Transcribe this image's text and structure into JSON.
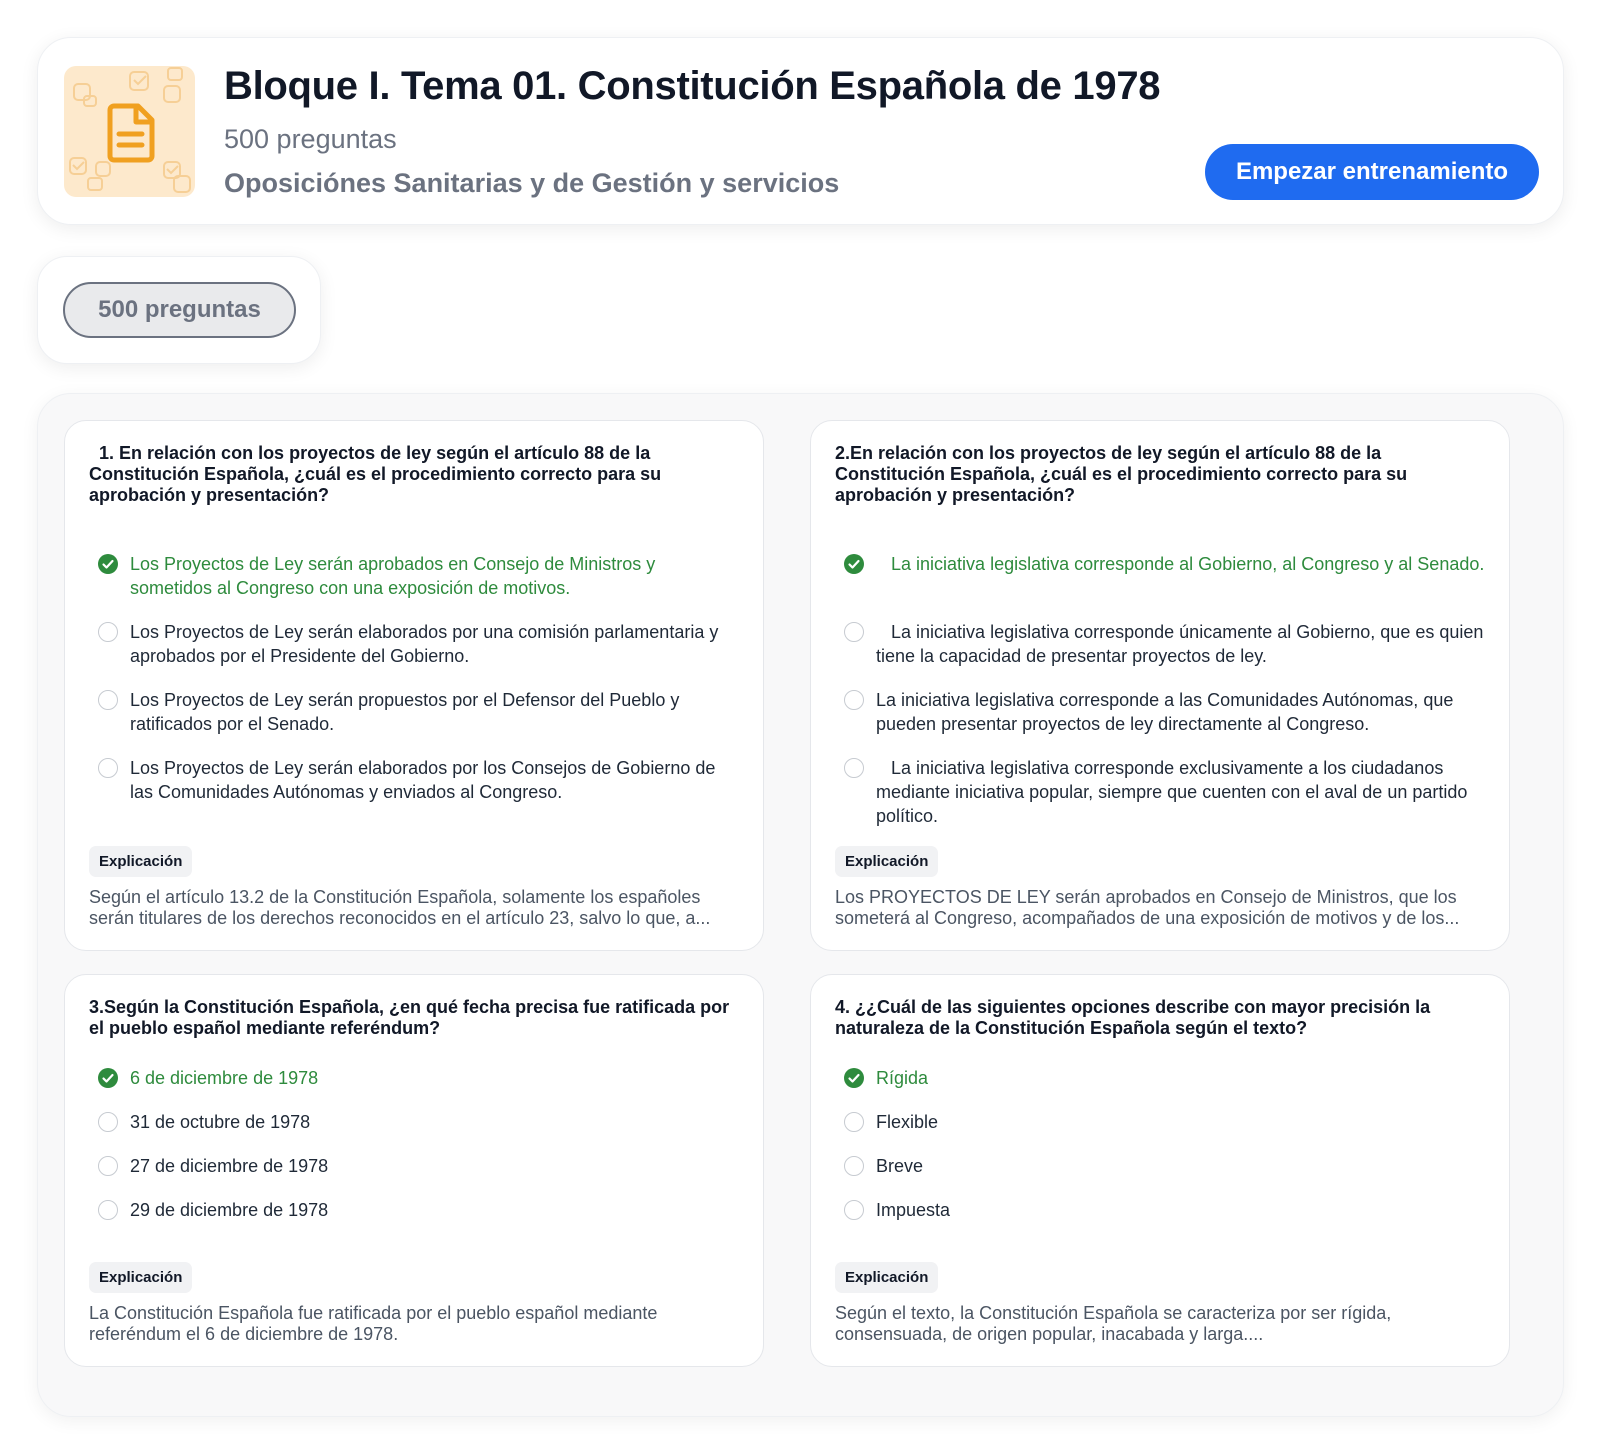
{
  "header": {
    "title": "Bloque I. Tema 01. Constitución Española de 1978",
    "question_count": "500 preguntas",
    "organization": "Oposiciónes Sanitarias y de Gestión y servicios",
    "start_button": "Empezar entrenamiento",
    "thumbnail_icon": "document-icon"
  },
  "filter": {
    "chip_label": "500 preguntas"
  },
  "explanation_label": "Explicación",
  "colors": {
    "accent": "#1f6bf0",
    "correct": "#2e8b3d",
    "thumbnail_bg": "#fde9cc",
    "thumbnail_icon": "#f0a020"
  },
  "questions": [
    {
      "text": "  1. En relación con los proyectos de ley según el artículo 88 de la Constitución Española, ¿cuál es el procedimiento correcto para su aprobación y presentación?",
      "options": [
        {
          "text": "Los Proyectos de Ley serán aprobados en Consejo de Ministros y sometidos al Congreso con una exposición de motivos.",
          "correct": true
        },
        {
          "text": "Los Proyectos de Ley serán elaborados por una comisión parlamentaria y aprobados por el Presidente del Gobierno.",
          "correct": false
        },
        {
          "text": "Los Proyectos de Ley serán propuestos por el Defensor del Pueblo y ratificados por el Senado.",
          "correct": false
        },
        {
          "text": "Los Proyectos de Ley serán elaborados por los Consejos de Gobierno de las Comunidades Autónomas y enviados al Congreso.",
          "correct": false
        }
      ],
      "explanation": "Según el artículo 13.2 de la Constitución Española, solamente los españoles serán titulares de los derechos reconocidos en el artículo 23, salvo lo que, a..."
    },
    {
      "text": "2.En relación con los proyectos de ley según el artículo 88 de la Constitución Española, ¿cuál es el procedimiento correcto para su aprobación y presentación?",
      "options": [
        {
          "text": "   La iniciativa legislativa corresponde al Gobierno, al Congreso y al Senado.",
          "correct": true
        },
        {
          "text": "   La iniciativa legislativa corresponde únicamente al Gobierno, que es quien tiene la capacidad de presentar proyectos de ley.",
          "correct": false
        },
        {
          "text": "La iniciativa legislativa corresponde a las Comunidades Autónomas, que pueden presentar proyectos de ley directamente al Congreso.",
          "correct": false
        },
        {
          "text": "   La iniciativa legislativa corresponde exclusivamente a los ciudadanos mediante iniciativa popular, siempre que cuenten con el aval de un partido político.",
          "correct": false
        }
      ],
      "explanation": "Los PROYECTOS DE LEY serán aprobados en Consejo de Ministros, que los someterá al Congreso, acompañados de una exposición de motivos y de los..."
    },
    {
      "text": "3.Según la Constitución Española, ¿en qué fecha precisa fue ratificada por el pueblo español mediante referéndum?",
      "options": [
        {
          "text": "6 de diciembre de 1978",
          "correct": true
        },
        {
          "text": "31 de octubre de 1978",
          "correct": false
        },
        {
          "text": "27 de diciembre de 1978",
          "correct": false
        },
        {
          "text": "29 de diciembre de 1978",
          "correct": false
        }
      ],
      "explanation": "La Constitución Española fue ratificada por el pueblo español mediante referéndum el 6 de diciembre de 1978."
    },
    {
      "text": "4. ¿¿Cuál de las siguientes opciones describe con mayor precisión la naturaleza de la Constitución Española según el texto?",
      "options": [
        {
          "text": "Rígida",
          "correct": true
        },
        {
          "text": "Flexible",
          "correct": false
        },
        {
          "text": "Breve",
          "correct": false
        },
        {
          "text": "Impuesta",
          "correct": false
        }
      ],
      "explanation": "Según el texto, la Constitución Española se caracteriza por ser rígida, consensuada, de origen popular, inacabada y larga...."
    }
  ]
}
